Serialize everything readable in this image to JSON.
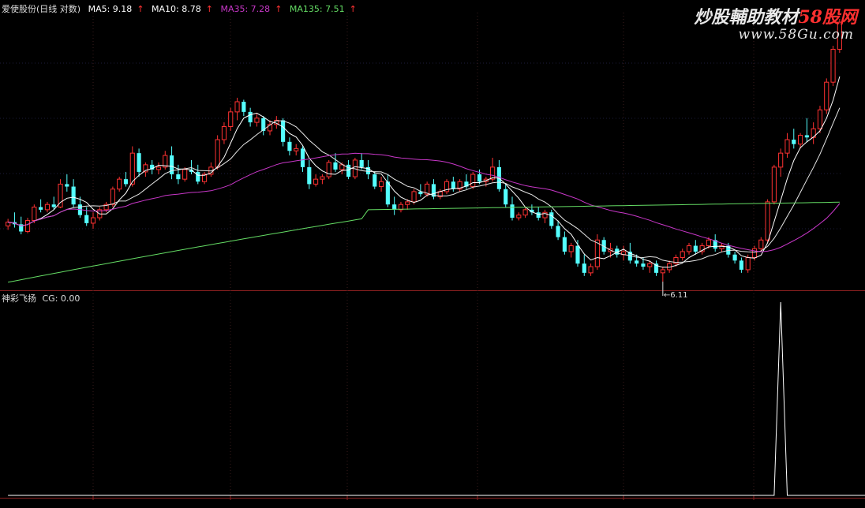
{
  "colors": {
    "background": "#000000",
    "up_candle": "#ff3232",
    "down_candle": "#54ffff",
    "ma5": "#ffffff",
    "ma10": "#e6e6e6",
    "ma35": "#c837c8",
    "ma135": "#64dc64",
    "indicator": "#ffffff",
    "frame": "#8b2020"
  },
  "header": {
    "stock_title": "爱使股份(日线 对数)",
    "ma5": "MA5: 9.18",
    "ma10": "MA10: 8.78",
    "ma35": "MA35: 7.28",
    "ma135": "MA135: 7.51",
    "arrow": "↑"
  },
  "subpanel": {
    "title": "神彩飞扬",
    "cg": "CG: 0.00"
  },
  "watermark": {
    "line1_prefix": "炒股輔助教材",
    "line1_brand": "58股网",
    "line2": "www.58Gu.com"
  },
  "chart_data": [
    {
      "type": "candlestick",
      "title": "爱使股份(日线 对数)",
      "y_scale": "log",
      "ylim": [
        6.0,
        12.0
      ],
      "low_marker": "6.11",
      "ohlc": [
        [
          7.05,
          7.18,
          6.98,
          7.12
        ],
        [
          7.12,
          7.3,
          7.02,
          7.08
        ],
        [
          7.08,
          7.22,
          6.9,
          6.95
        ],
        [
          6.95,
          7.2,
          6.92,
          7.15
        ],
        [
          7.15,
          7.45,
          7.1,
          7.4
        ],
        [
          7.4,
          7.55,
          7.3,
          7.35
        ],
        [
          7.35,
          7.5,
          7.3,
          7.45
        ],
        [
          7.45,
          7.6,
          7.35,
          7.4
        ],
        [
          7.4,
          7.95,
          7.38,
          7.85
        ],
        [
          7.85,
          8.05,
          7.7,
          7.8
        ],
        [
          7.8,
          7.95,
          7.4,
          7.45
        ],
        [
          7.45,
          7.6,
          7.2,
          7.25
        ],
        [
          7.25,
          7.4,
          7.05,
          7.1
        ],
        [
          7.1,
          7.3,
          7.0,
          7.2
        ],
        [
          7.2,
          7.4,
          7.15,
          7.35
        ],
        [
          7.35,
          7.5,
          7.3,
          7.45
        ],
        [
          7.45,
          7.8,
          7.4,
          7.75
        ],
        [
          7.75,
          8.0,
          7.7,
          7.95
        ],
        [
          7.95,
          8.1,
          7.8,
          7.85
        ],
        [
          7.85,
          8.65,
          7.8,
          8.5
        ],
        [
          8.5,
          8.6,
          8.0,
          8.1
        ],
        [
          8.1,
          8.3,
          8.0,
          8.25
        ],
        [
          8.25,
          8.35,
          8.05,
          8.15
        ],
        [
          8.15,
          8.3,
          8.05,
          8.2
        ],
        [
          8.2,
          8.55,
          8.15,
          8.45
        ],
        [
          8.45,
          8.65,
          7.95,
          8.05
        ],
        [
          8.05,
          8.25,
          7.85,
          7.95
        ],
        [
          7.95,
          8.2,
          7.9,
          8.15
        ],
        [
          8.15,
          8.35,
          8.05,
          8.1
        ],
        [
          8.1,
          8.25,
          7.85,
          7.9
        ],
        [
          7.9,
          8.1,
          7.85,
          8.05
        ],
        [
          8.05,
          8.3,
          8.0,
          8.2
        ],
        [
          8.2,
          8.9,
          8.15,
          8.8
        ],
        [
          8.8,
          9.2,
          8.7,
          9.1
        ],
        [
          9.1,
          9.55,
          9.0,
          9.45
        ],
        [
          9.45,
          9.8,
          9.25,
          9.7
        ],
        [
          9.7,
          9.75,
          9.35,
          9.45
        ],
        [
          9.45,
          9.55,
          9.1,
          9.2
        ],
        [
          9.2,
          9.4,
          9.1,
          9.3
        ],
        [
          9.3,
          9.35,
          8.9,
          9.0
        ],
        [
          9.0,
          9.25,
          8.9,
          9.15
        ],
        [
          9.15,
          9.35,
          9.05,
          9.25
        ],
        [
          9.25,
          9.3,
          8.65,
          8.75
        ],
        [
          8.75,
          8.85,
          8.45,
          8.55
        ],
        [
          8.55,
          8.7,
          8.45,
          8.6
        ],
        [
          8.6,
          8.65,
          8.1,
          8.2
        ],
        [
          8.2,
          8.35,
          7.75,
          7.85
        ],
        [
          7.85,
          8.05,
          7.8,
          7.95
        ],
        [
          7.95,
          8.05,
          7.85,
          8.0
        ],
        [
          8.0,
          8.35,
          7.95,
          8.3
        ],
        [
          8.3,
          8.5,
          8.1,
          8.15
        ],
        [
          8.15,
          8.3,
          8.05,
          8.25
        ],
        [
          8.25,
          8.35,
          7.95,
          8.0
        ],
        [
          8.0,
          8.4,
          7.95,
          8.35
        ],
        [
          8.35,
          8.5,
          8.15,
          8.2
        ],
        [
          8.2,
          8.35,
          7.95,
          8.05
        ],
        [
          8.05,
          8.1,
          7.75,
          7.8
        ],
        [
          7.8,
          8.0,
          7.7,
          7.9
        ],
        [
          7.9,
          8.05,
          7.4,
          7.45
        ],
        [
          7.45,
          7.6,
          7.25,
          7.35
        ],
        [
          7.35,
          7.5,
          7.3,
          7.45
        ],
        [
          7.45,
          7.55,
          7.35,
          7.5
        ],
        [
          7.5,
          7.75,
          7.45,
          7.7
        ],
        [
          7.7,
          7.85,
          7.6,
          7.65
        ],
        [
          7.65,
          7.9,
          7.6,
          7.85
        ],
        [
          7.85,
          7.95,
          7.55,
          7.6
        ],
        [
          7.6,
          7.75,
          7.55,
          7.7
        ],
        [
          7.7,
          7.95,
          7.65,
          7.9
        ],
        [
          7.9,
          8.0,
          7.7,
          7.75
        ],
        [
          7.75,
          7.95,
          7.7,
          7.9
        ],
        [
          7.9,
          8.05,
          7.75,
          7.8
        ],
        [
          7.8,
          8.1,
          7.75,
          8.05
        ],
        [
          8.05,
          8.15,
          7.85,
          7.9
        ],
        [
          7.9,
          8.0,
          7.8,
          7.95
        ],
        [
          7.95,
          8.4,
          7.9,
          8.2
        ],
        [
          8.2,
          8.35,
          7.7,
          7.75
        ],
        [
          7.75,
          7.85,
          7.4,
          7.45
        ],
        [
          7.45,
          7.6,
          7.15,
          7.2
        ],
        [
          7.2,
          7.3,
          7.15,
          7.25
        ],
        [
          7.25,
          7.4,
          7.2,
          7.35
        ],
        [
          7.35,
          7.45,
          7.25,
          7.3
        ],
        [
          7.3,
          7.4,
          7.15,
          7.2
        ],
        [
          7.2,
          7.35,
          7.1,
          7.3
        ],
        [
          7.3,
          7.35,
          7.0,
          7.05
        ],
        [
          7.05,
          7.15,
          6.8,
          6.85
        ],
        [
          6.85,
          6.95,
          6.55,
          6.6
        ],
        [
          6.6,
          6.75,
          6.5,
          6.7
        ],
        [
          6.7,
          6.8,
          6.35,
          6.4
        ],
        [
          6.4,
          6.55,
          6.2,
          6.25
        ],
        [
          6.25,
          6.4,
          6.2,
          6.35
        ],
        [
          6.35,
          6.9,
          6.3,
          6.8
        ],
        [
          6.8,
          6.85,
          6.55,
          6.6
        ],
        [
          6.6,
          6.75,
          6.5,
          6.65
        ],
        [
          6.65,
          6.7,
          6.5,
          6.55
        ],
        [
          6.55,
          6.7,
          6.45,
          6.6
        ],
        [
          6.6,
          6.75,
          6.4,
          6.45
        ],
        [
          6.45,
          6.55,
          6.35,
          6.4
        ],
        [
          6.4,
          6.5,
          6.3,
          6.35
        ],
        [
          6.35,
          6.45,
          6.25,
          6.4
        ],
        [
          6.4,
          6.45,
          6.2,
          6.25
        ],
        [
          6.25,
          6.35,
          6.11,
          6.3
        ],
        [
          6.3,
          6.45,
          6.25,
          6.4
        ],
        [
          6.4,
          6.55,
          6.35,
          6.5
        ],
        [
          6.5,
          6.65,
          6.45,
          6.6
        ],
        [
          6.6,
          6.75,
          6.55,
          6.7
        ],
        [
          6.7,
          6.8,
          6.55,
          6.6
        ],
        [
          6.6,
          6.75,
          6.55,
          6.7
        ],
        [
          6.7,
          6.85,
          6.65,
          6.8
        ],
        [
          6.8,
          6.9,
          6.6,
          6.65
        ],
        [
          6.65,
          6.75,
          6.6,
          6.7
        ],
        [
          6.7,
          6.75,
          6.5,
          6.55
        ],
        [
          6.55,
          6.6,
          6.4,
          6.45
        ],
        [
          6.45,
          6.5,
          6.25,
          6.3
        ],
        [
          6.3,
          6.55,
          6.25,
          6.5
        ],
        [
          6.5,
          6.7,
          6.45,
          6.65
        ],
        [
          6.65,
          6.85,
          6.6,
          6.8
        ],
        [
          6.8,
          7.55,
          6.75,
          7.5
        ],
        [
          7.5,
          8.25,
          7.45,
          8.2
        ],
        [
          8.2,
          8.6,
          8.0,
          8.5
        ],
        [
          8.5,
          8.95,
          8.4,
          8.8
        ],
        [
          8.8,
          9.05,
          8.6,
          8.7
        ],
        [
          8.7,
          8.95,
          8.6,
          8.9
        ],
        [
          8.9,
          9.3,
          8.75,
          8.85
        ],
        [
          8.85,
          9.2,
          8.7,
          9.05
        ],
        [
          9.05,
          9.6,
          8.95,
          9.5
        ],
        [
          9.5,
          10.3,
          9.4,
          10.2
        ],
        [
          10.2,
          11.2,
          10.1,
          11.1
        ],
        [
          11.1,
          12.0,
          11.0,
          11.9
        ]
      ],
      "moving_averages": [
        {
          "name": "MA5",
          "value": 9.18
        },
        {
          "name": "MA10",
          "value": 8.78
        },
        {
          "name": "MA35",
          "value": 7.28
        },
        {
          "name": "MA135",
          "value": 7.51
        }
      ]
    },
    {
      "type": "line",
      "title": "神彩飞扬",
      "series_label": "CG",
      "current_value": 0.0,
      "ylim": [
        0,
        1
      ],
      "values": [
        0,
        0,
        0,
        0,
        0,
        0,
        0,
        0,
        0,
        0,
        0,
        0,
        0,
        0,
        0,
        0,
        0,
        0,
        0,
        0,
        0,
        0,
        0,
        0,
        0,
        0,
        0,
        0,
        0,
        0,
        0,
        0,
        0,
        0,
        0,
        0,
        0,
        0,
        0,
        0,
        0,
        0,
        0,
        0,
        0,
        0,
        0,
        0,
        0,
        0,
        0,
        0,
        0,
        0,
        0,
        0,
        0,
        0,
        0,
        0,
        0,
        0,
        0,
        0,
        0,
        0,
        0,
        0,
        0,
        0,
        0,
        0,
        0,
        0,
        0,
        0,
        0,
        0,
        0,
        0,
        0,
        0,
        0,
        0,
        0,
        0,
        0,
        0,
        0,
        0,
        0,
        0,
        0,
        0,
        0,
        0,
        0,
        0,
        0,
        0,
        0,
        0,
        0,
        0,
        0,
        0,
        0,
        0,
        0,
        0,
        0,
        0,
        0,
        0,
        0,
        0,
        0,
        0,
        1,
        0,
        0,
        0,
        0,
        0,
        0,
        0,
        0,
        0,
        0,
        0,
        0,
        0
      ]
    }
  ]
}
